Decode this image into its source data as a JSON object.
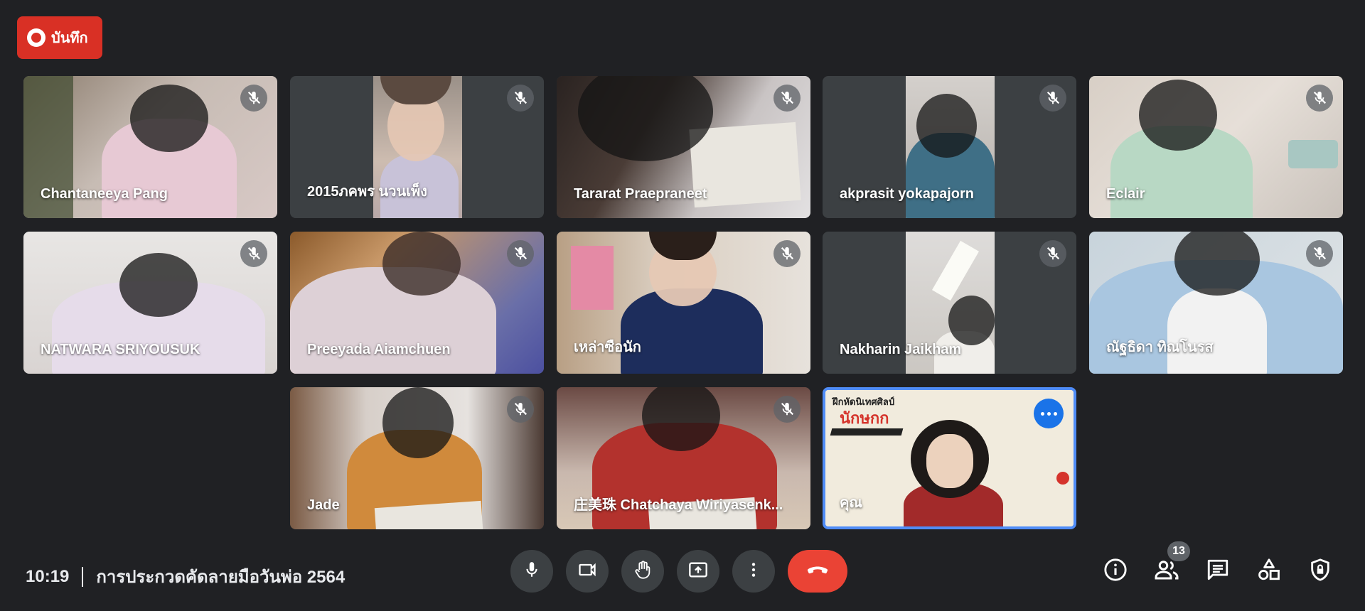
{
  "recording": {
    "label": "บันทึก"
  },
  "participants": [
    {
      "name": "Chantaneeya Pang"
    },
    {
      "name": "2015ภคพร นวนเพ็ง"
    },
    {
      "name": "Tararat Praepraneet"
    },
    {
      "name": "akprasit yokapajorn"
    },
    {
      "name": "Eclair"
    },
    {
      "name": "NATWARA SRIYOUSUK"
    },
    {
      "name": "Preeyada Aiamchuen"
    },
    {
      "name": "เหล่าซือนัก"
    },
    {
      "name": "Nakharin Jaikham"
    },
    {
      "name": "ณัฐธิดา ทิณโนรส"
    },
    {
      "name": "Jade"
    },
    {
      "name": "庄美珠 Chatchaya Wiriyasenk..."
    },
    {
      "name": "คุณ"
    }
  ],
  "self_background": {
    "line1": "ฝึกหัดนิเทศศิลป์",
    "line2": "นักษกก"
  },
  "meeting": {
    "time": "10:19",
    "title": "การประกวดคัดลายมือวันพ่อ 2564"
  },
  "people_count": "13",
  "colors": {
    "background": "#202124",
    "record": "#d93025",
    "hangup": "#ea4335",
    "accent": "#1a73e8"
  },
  "icons": [
    "mic-icon",
    "camera-icon",
    "raise-hand-icon",
    "present-icon",
    "more-options-icon",
    "end-call-icon",
    "info-icon",
    "people-icon",
    "chat-icon",
    "activities-icon",
    "host-controls-icon"
  ]
}
